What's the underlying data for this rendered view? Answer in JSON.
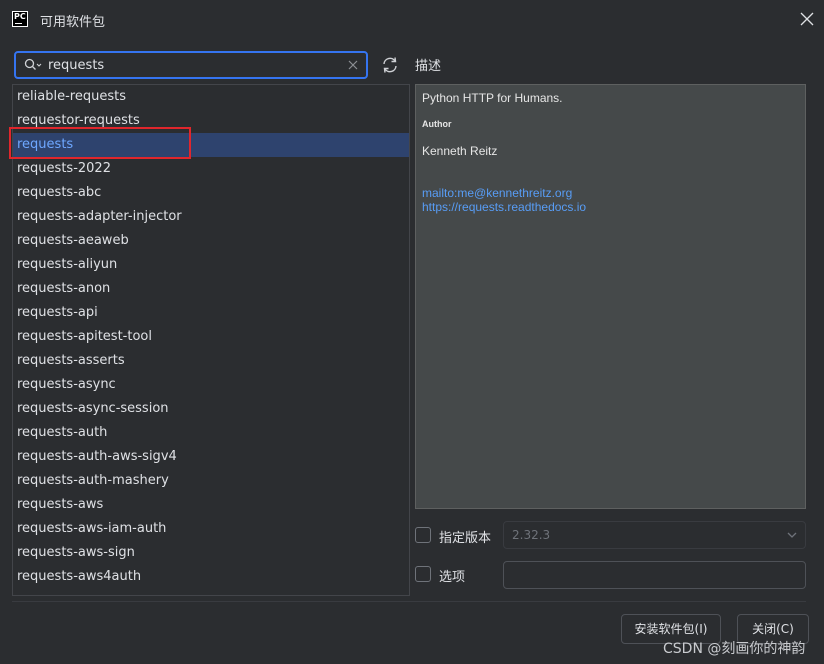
{
  "window": {
    "title": "可用软件包",
    "app_icon_text": "PC"
  },
  "search": {
    "value": "requests"
  },
  "packages": [
    "reliable-requests",
    "requestor-requests",
    "requests",
    "requests-2022",
    "requests-abc",
    "requests-adapter-injector",
    "requests-aeaweb",
    "requests-aliyun",
    "requests-anon",
    "requests-api",
    "requests-apitest-tool",
    "requests-asserts",
    "requests-async",
    "requests-async-session",
    "requests-auth",
    "requests-auth-aws-sigv4",
    "requests-auth-mashery",
    "requests-aws",
    "requests-aws-iam-auth",
    "requests-aws-sign",
    "requests-aws4auth"
  ],
  "selected_package": "requests",
  "description": {
    "label": "描述",
    "summary": "Python HTTP for Humans.",
    "author_heading": "Author",
    "author": "Kenneth Reitz",
    "email_link": "mailto:me@kennethreitz.org",
    "docs_link": "https://requests.readthedocs.io"
  },
  "options": {
    "specify_version_label": "指定版本",
    "version_value": "2.32.3",
    "options_label": "选项"
  },
  "buttons": {
    "install": "安装软件包(I)",
    "close": "关闭(C)"
  },
  "watermark": "CSDN @刻画你的神韵",
  "colors": {
    "accent": "#3574f0",
    "selection": "#2e436e",
    "highlight_box": "#e0262c",
    "link": "#589df6"
  }
}
